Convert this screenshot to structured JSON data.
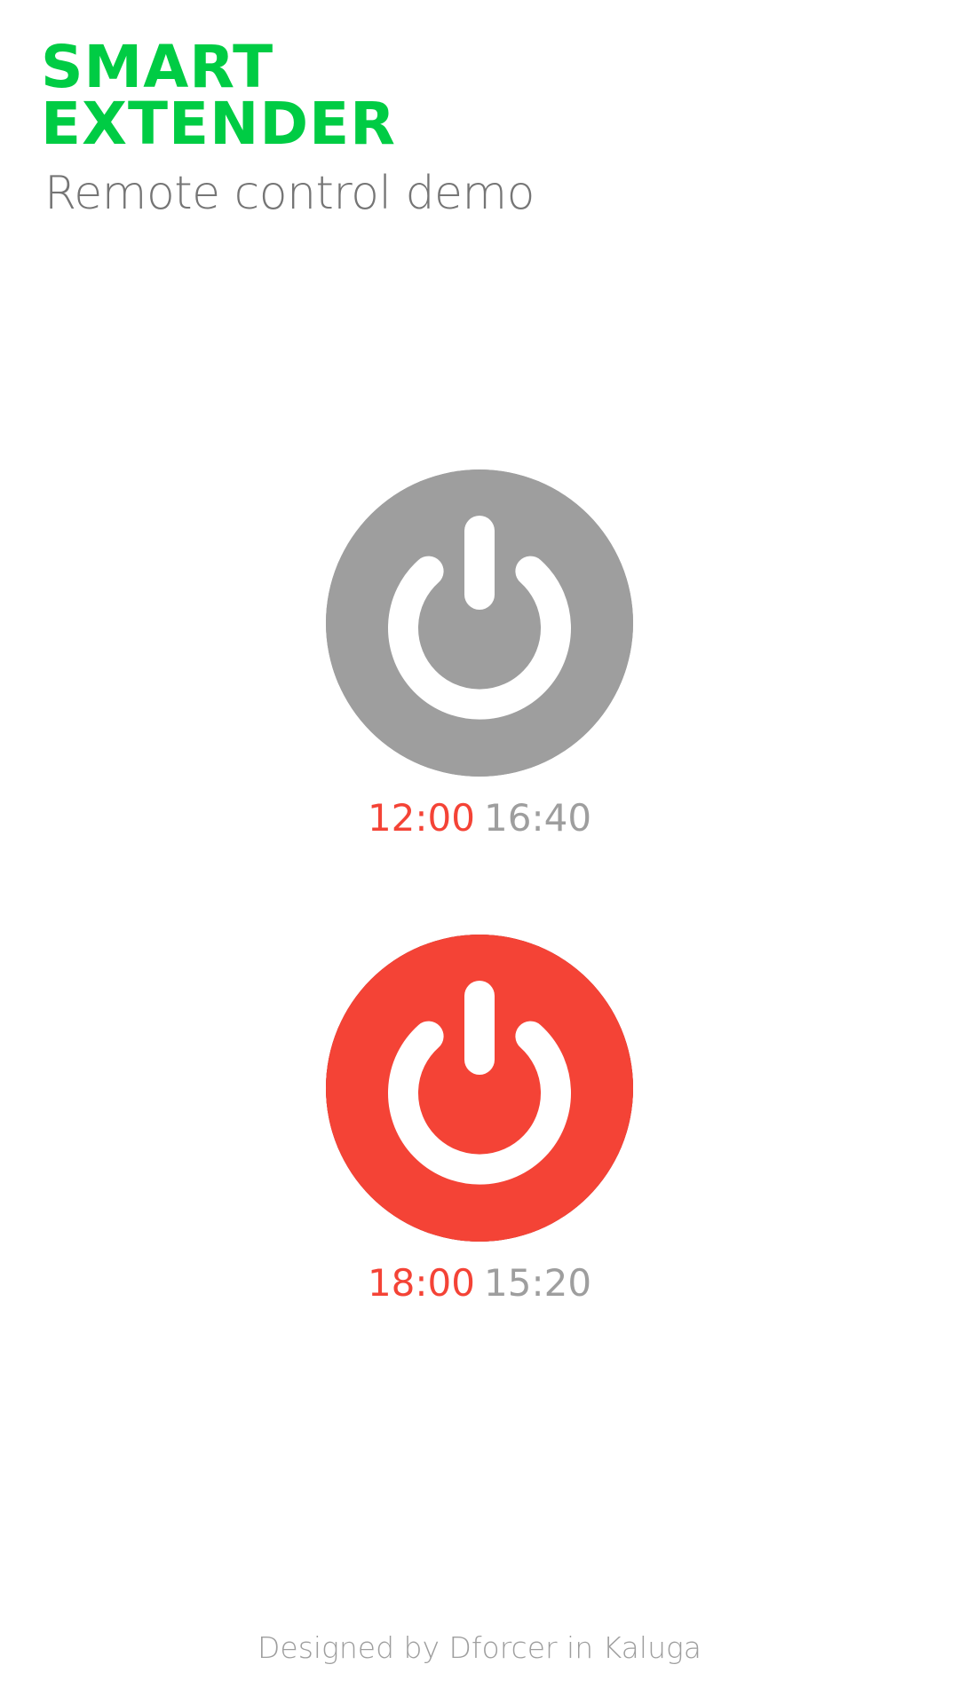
{
  "header": {
    "brand_line1": "SMART",
    "brand_line2": "EXTENDER",
    "subtitle": "Remote control demo"
  },
  "devices": [
    {
      "state": "off",
      "button_color": "#9e9e9e",
      "icon_name": "power-icon",
      "on_time": "12:00",
      "off_time": "16:40"
    },
    {
      "state": "on",
      "button_color": "#f44336",
      "icon_name": "power-icon",
      "on_time": "18:00",
      "off_time": "15:20"
    }
  ],
  "footer": {
    "credit": "Designed by Dforcer in Kaluga"
  },
  "colors": {
    "brand": "#00cc44",
    "time_on": "#f44336",
    "time_off": "#9e9e9e",
    "subtitle": "#757575",
    "icon": "#ffffff"
  }
}
